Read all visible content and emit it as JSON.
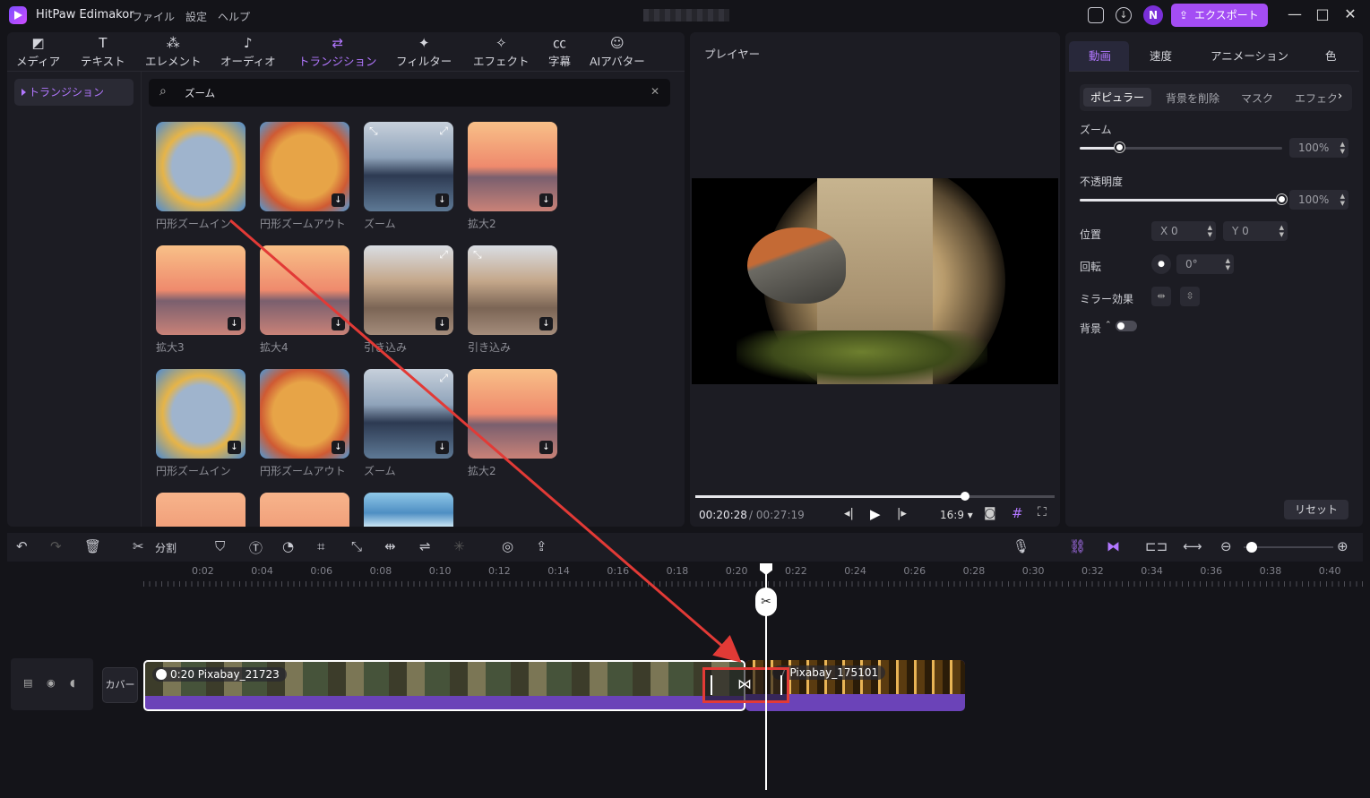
{
  "app": {
    "title": "HitPaw Edimakor",
    "menu": [
      "ファイル",
      "設定",
      "ヘルプ"
    ],
    "avatar": "N",
    "export_label": "エクスポート"
  },
  "toolbar": {
    "items": [
      {
        "label": "メディア",
        "icon": "media-icon"
      },
      {
        "label": "テキスト",
        "icon": "text-icon"
      },
      {
        "label": "エレメント",
        "icon": "elements-icon"
      },
      {
        "label": "オーディオ",
        "icon": "audio-icon"
      },
      {
        "label": "トランジション",
        "icon": "transition-icon",
        "active": true
      },
      {
        "label": "フィルター",
        "icon": "filter-icon"
      },
      {
        "label": "エフェクト",
        "icon": "effect-icon"
      },
      {
        "label": "字幕",
        "icon": "subtitle-icon"
      },
      {
        "label": "AIアバター",
        "icon": "ai-avatar-icon"
      }
    ]
  },
  "library": {
    "category": "トランジション",
    "search_value": "ズーム",
    "items": [
      {
        "label": "円形ズームイン"
      },
      {
        "label": "円形ズームアウト"
      },
      {
        "label": "ズーム"
      },
      {
        "label": "拡大2"
      },
      {
        "label": "拡大3"
      },
      {
        "label": "拡大4"
      },
      {
        "label": "引き込み"
      },
      {
        "label": "引き込み"
      },
      {
        "label": "円形ズームイン"
      },
      {
        "label": "円形ズームアウト"
      },
      {
        "label": "ズーム"
      },
      {
        "label": "拡大2"
      }
    ]
  },
  "player": {
    "title": "プレイヤー",
    "current_time": "00:20:28",
    "total_time": "/ 00:27:19",
    "aspect": "16:9",
    "progress": 0.75
  },
  "properties": {
    "tabs": [
      "動画",
      "速度",
      "アニメーション",
      "色"
    ],
    "subtabs": [
      "ポピュラー",
      "背景を削除",
      "マスク",
      "エフェクト"
    ],
    "zoom_label": "ズーム",
    "zoom_value": "100%",
    "zoom_level": 0.2,
    "opacity_label": "不透明度",
    "opacity_value": "100%",
    "opacity_level": 1.0,
    "position_label": "位置",
    "pos_x": "X 0",
    "pos_y": "Y 0",
    "rotation_label": "回転",
    "rotation_value": "0°",
    "mirror_label": "ミラー効果",
    "background_label": "背景",
    "reset_label": "リセット"
  },
  "timeline": {
    "split_label": "分割",
    "ruler": [
      "0:02",
      "0:04",
      "0:06",
      "0:08",
      "0:10",
      "0:12",
      "0:14",
      "0:16",
      "0:18",
      "0:20",
      "0:22",
      "0:24",
      "0:26",
      "0:28",
      "0:30",
      "0:32",
      "0:34",
      "0:36",
      "0:38",
      "0:40"
    ],
    "cover_label": "カバー",
    "clip1_label": "0:20 Pixabay_21723",
    "clip2_label": "7 Pixabay_175101"
  },
  "colors": {
    "accent": "#b277ff",
    "export": "#a44df4",
    "highlight": "#e23a36",
    "clip": "#6b43b8"
  }
}
